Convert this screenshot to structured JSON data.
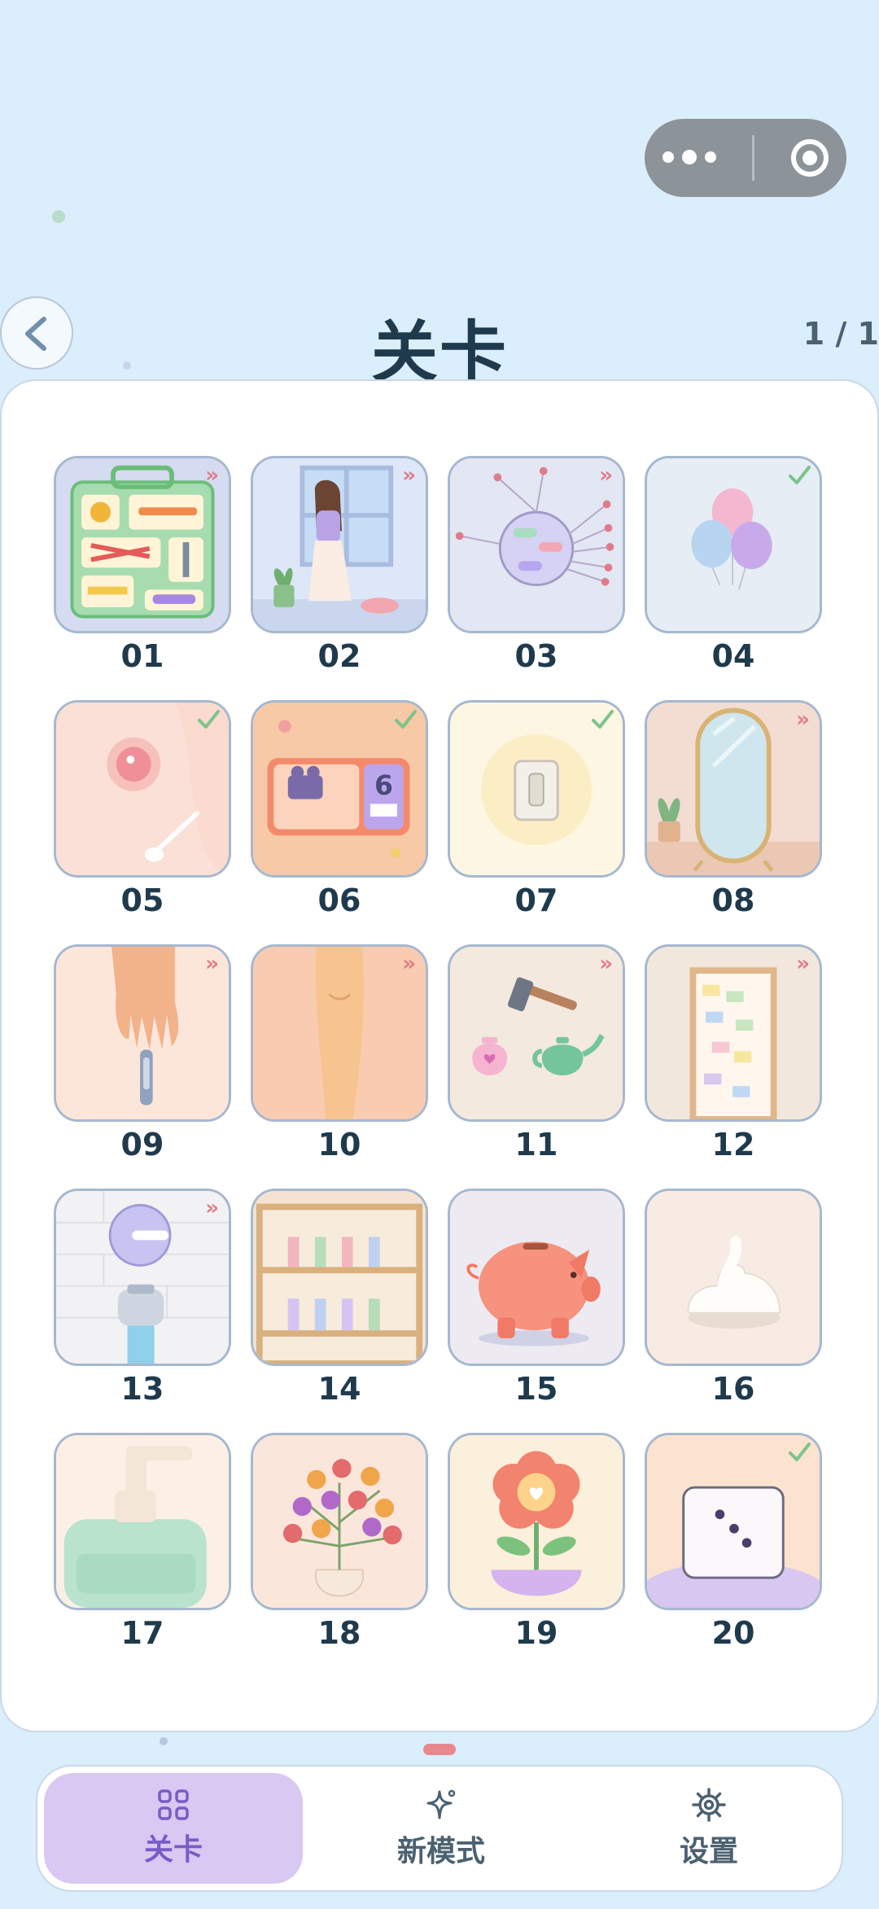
{
  "header": {
    "title": "关卡",
    "pager": "1 / 1"
  },
  "levels": [
    {
      "num": "01",
      "badge": "arrows",
      "scene": "toolbox"
    },
    {
      "num": "02",
      "badge": "arrows",
      "scene": "girl-window"
    },
    {
      "num": "03",
      "badge": "arrows",
      "scene": "pin-ball"
    },
    {
      "num": "04",
      "badge": "check",
      "scene": "balloons"
    },
    {
      "num": "05",
      "badge": "check",
      "scene": "spoon-bowl"
    },
    {
      "num": "06",
      "badge": "check",
      "scene": "movie-ticket"
    },
    {
      "num": "07",
      "badge": "check",
      "scene": "light-switch"
    },
    {
      "num": "08",
      "badge": "arrows",
      "scene": "mirror"
    },
    {
      "num": "09",
      "badge": "arrows",
      "scene": "hand-nail-clipper"
    },
    {
      "num": "10",
      "badge": "arrows",
      "scene": "leg"
    },
    {
      "num": "11",
      "badge": "arrows",
      "scene": "hammer-teapot"
    },
    {
      "num": "12",
      "badge": "arrows",
      "scene": "door-notes"
    },
    {
      "num": "13",
      "badge": "arrows",
      "scene": "faucet"
    },
    {
      "num": "14",
      "badge": "none",
      "scene": "bookshelf"
    },
    {
      "num": "15",
      "badge": "none",
      "scene": "piggy-bank"
    },
    {
      "num": "16",
      "badge": "none",
      "scene": "cream"
    },
    {
      "num": "17",
      "badge": "none",
      "scene": "soap-bottle"
    },
    {
      "num": "18",
      "badge": "none",
      "scene": "fruit-tree"
    },
    {
      "num": "19",
      "badge": "none",
      "scene": "flower-pot"
    },
    {
      "num": "20",
      "badge": "check",
      "scene": "dice"
    }
  ],
  "tabbar": {
    "tabs": [
      {
        "label": "关卡",
        "icon": "grid-icon",
        "active": true
      },
      {
        "label": "新模式",
        "icon": "sparkle-icon",
        "active": false
      },
      {
        "label": "设置",
        "icon": "gear-icon",
        "active": false
      }
    ]
  },
  "colors": {
    "background": "#dbeefb",
    "accent": "#7a5bc7",
    "active_tab": "#d9c8f1",
    "badge": "#e07b8a",
    "check": "#7cc48a"
  }
}
